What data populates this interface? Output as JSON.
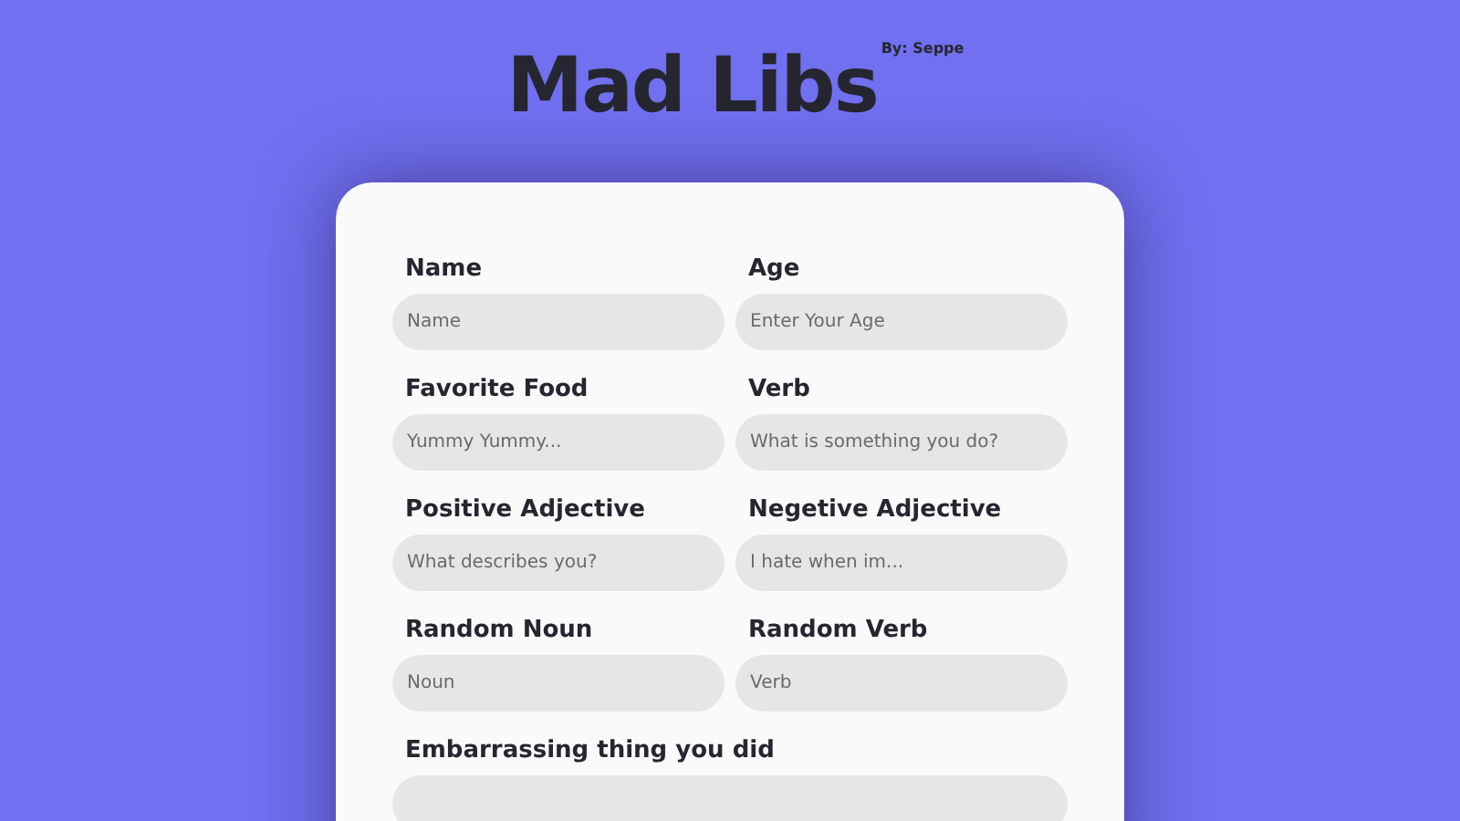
{
  "header": {
    "title": "Mad Libs",
    "byline": "By: Seppe"
  },
  "fields": [
    {
      "label": "Name",
      "placeholder": "Name",
      "kind": "half"
    },
    {
      "label": "Age",
      "placeholder": "Enter Your Age",
      "kind": "half"
    },
    {
      "label": "Favorite Food",
      "placeholder": "Yummy Yummy...",
      "kind": "half"
    },
    {
      "label": "Verb",
      "placeholder": "What is something you do?",
      "kind": "half"
    },
    {
      "label": "Positive Adjective",
      "placeholder": "What describes you?",
      "kind": "half"
    },
    {
      "label": "Negetive Adjective",
      "placeholder": "I hate when im...",
      "kind": "half"
    },
    {
      "label": "Random Noun",
      "placeholder": "Noun",
      "kind": "half"
    },
    {
      "label": "Random Verb",
      "placeholder": "Verb",
      "kind": "half"
    },
    {
      "label": "Embarrassing thing you did",
      "kind": "wide"
    }
  ]
}
